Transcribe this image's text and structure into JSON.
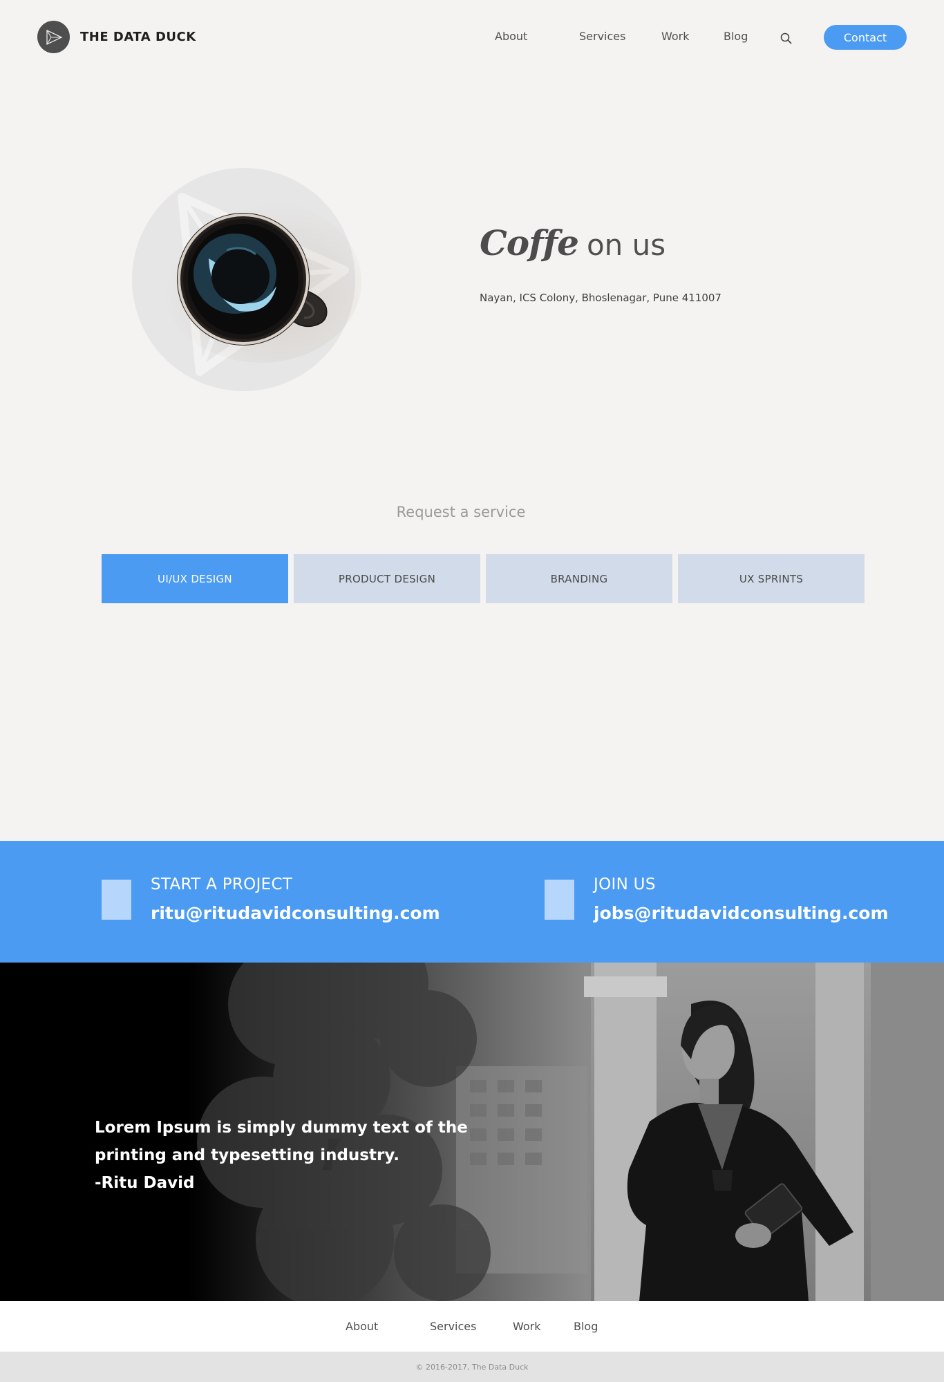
{
  "brand": {
    "name": "THE DATA DUCK",
    "logo_icon": "paper-plane-icon"
  },
  "nav": {
    "items": [
      {
        "label": "About"
      },
      {
        "label": "Services"
      },
      {
        "label": "Work"
      },
      {
        "label": "Blog"
      }
    ],
    "search_icon": "search-icon",
    "contact_label": "Contact"
  },
  "hero": {
    "title_script": "Coffe",
    "title_rest": "on us",
    "address": "Nayan, ICS Colony, Bhoslenagar, Pune  411007"
  },
  "services": {
    "title": "Request a service",
    "tabs": [
      {
        "label": "UI/UX DESIGN",
        "active": true
      },
      {
        "label": "PRODUCT DESIGN",
        "active": false
      },
      {
        "label": "BRANDING",
        "active": false
      },
      {
        "label": "UX SPRINTS",
        "active": false
      }
    ]
  },
  "contact_band": {
    "start_label": "START A PROJECT",
    "start_email": "ritu@ritudavidconsulting.com",
    "join_label": "JOIN US",
    "join_email": "jobs@ritudavidconsulting.com"
  },
  "testimonial": {
    "line1": "Lorem Ipsum is simply dummy text of the",
    "line2": "printing and typesetting industry.",
    "author": "-Ritu David"
  },
  "footer": {
    "items": [
      {
        "label": "About"
      },
      {
        "label": "Services"
      },
      {
        "label": "Work"
      },
      {
        "label": "Blog"
      }
    ],
    "copyright": "© 2016-2017, The Data Duck"
  },
  "colors": {
    "accent": "#4b9bf3",
    "background": "#f4f3f1",
    "tab_inactive": "#d2dbea",
    "band_square": "#b7d6fb"
  }
}
